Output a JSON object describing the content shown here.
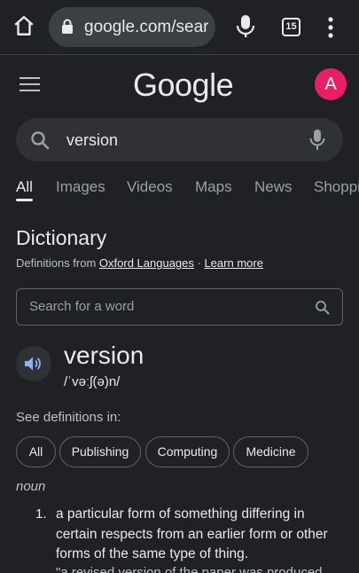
{
  "browser": {
    "url": "google.com/search?q=version",
    "tab_count": "15"
  },
  "header": {
    "logo": "Google",
    "avatar_letter": "A",
    "avatar_color": "#e91e63"
  },
  "search": {
    "query": "version"
  },
  "tabs": [
    "All",
    "Images",
    "Videos",
    "Maps",
    "News",
    "Shopping"
  ],
  "dictionary": {
    "title": "Dictionary",
    "source_prefix": "Definitions from ",
    "source_link": "Oxford Languages",
    "separator": " · ",
    "learn_more": "Learn more",
    "word_search_placeholder": "Search for a word",
    "word": "version",
    "phonetic": "/ˈvəːʃ(ə)n/",
    "see_definitions_label": "See definitions in:",
    "chips": [
      "All",
      "Publishing",
      "Computing",
      "Medicine"
    ],
    "part_of_speech": "noun",
    "definitions": [
      {
        "number": "1.",
        "text": "a particular form of something differing in certain respects from an earlier form or other forms of the same type of thing.",
        "example": "\"a revised version of the paper was produced"
      }
    ]
  }
}
